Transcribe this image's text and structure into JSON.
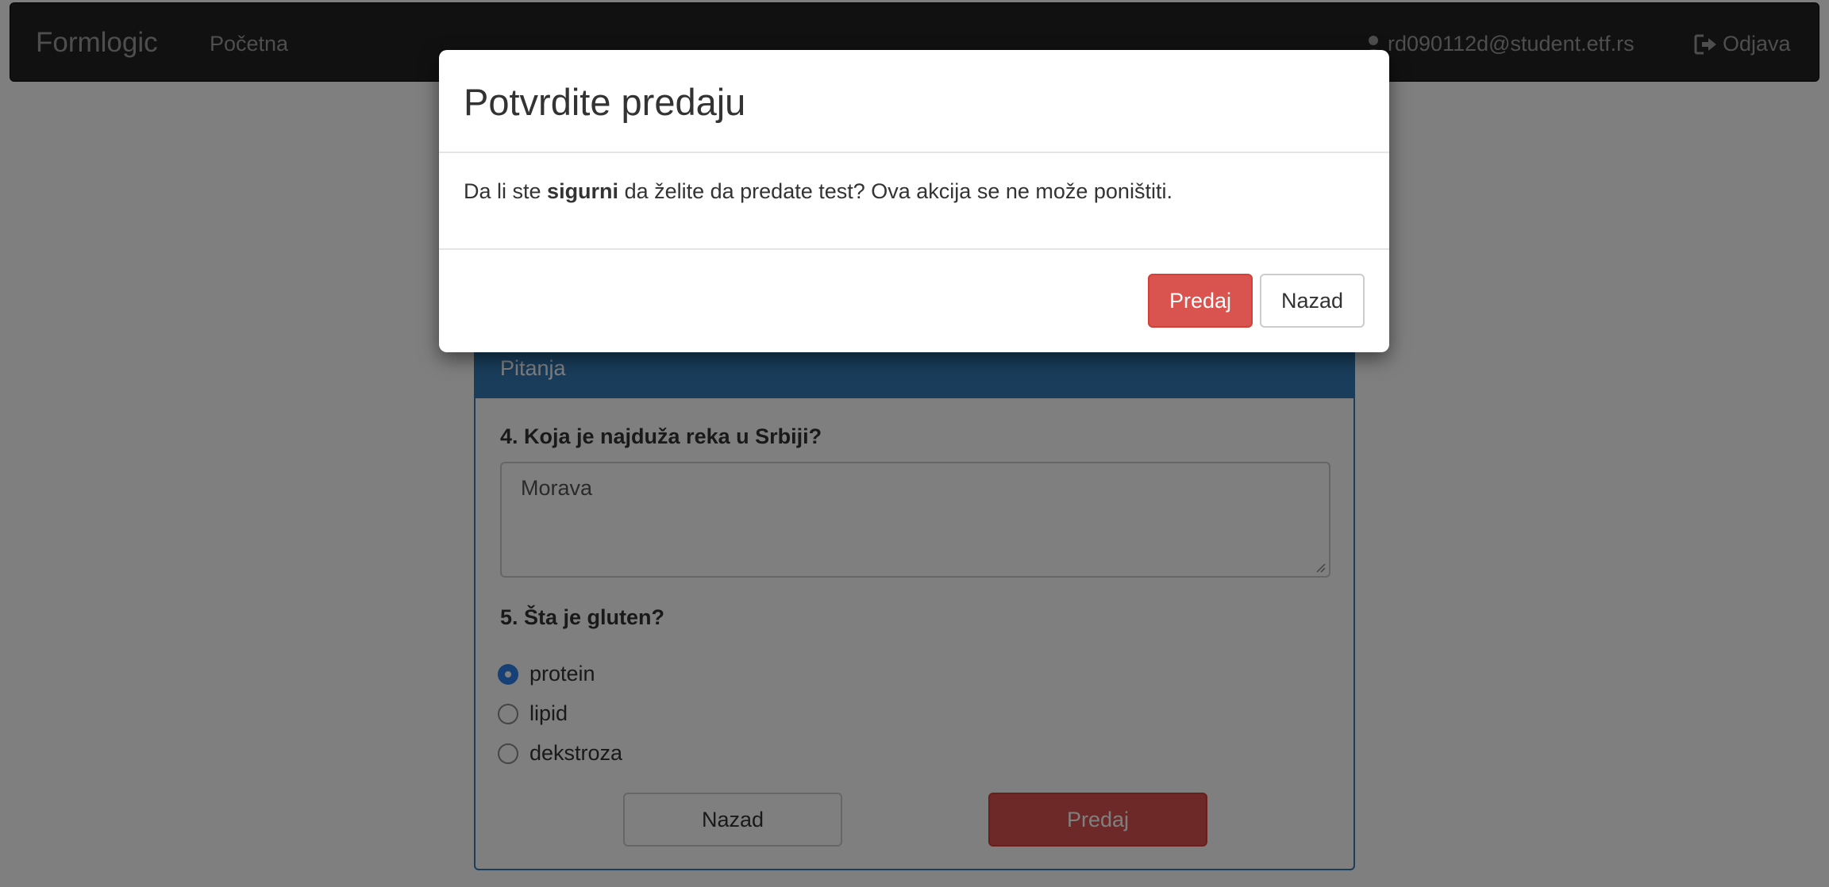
{
  "navbar": {
    "brand": "Formlogic",
    "home": "Početna",
    "user_email": "rd090112d@student.etf.rs",
    "logout": "Odjava"
  },
  "panel": {
    "heading": "Pitanja",
    "q4": {
      "text": "4. Koja je najduža reka u Srbiji?",
      "answer": "Morava"
    },
    "q5": {
      "text": "5. Šta je gluten?",
      "options": [
        "protein",
        "lipid",
        "dekstroza"
      ],
      "selected": "protein"
    },
    "back_label": "Nazad",
    "submit_label": "Predaj"
  },
  "modal": {
    "title": "Potvrdite predaju",
    "body_before": "Da li ste ",
    "body_bold": "sigurni",
    "body_after": " da želite da predate test? Ova akcija se ne može poništiti.",
    "confirm_label": "Predaj",
    "cancel_label": "Nazad"
  },
  "colors": {
    "primary": "#337ab7",
    "danger": "#d9534f",
    "navbar": "#222222"
  }
}
